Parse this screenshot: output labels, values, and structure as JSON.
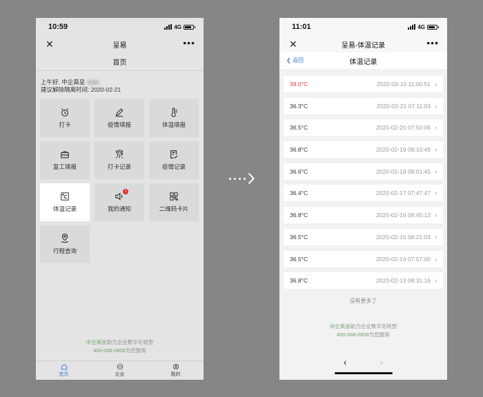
{
  "left": {
    "status_time": "10:59",
    "network": "4G",
    "app_title": "呈易",
    "page_title": "首页",
    "greeting": "上午好, 中企高呈",
    "quarantine_line": "建议解除隔离时间: 2020-02-21",
    "grid": [
      {
        "label": "打卡",
        "icon": "alarm-clock-icon"
      },
      {
        "label": "疫情填报",
        "icon": "pencil-icon"
      },
      {
        "label": "体温填报",
        "icon": "thermometer-icon"
      },
      {
        "label": "复工填报",
        "icon": "briefcase-icon"
      },
      {
        "label": "打卡记录",
        "icon": "fingerprint-icon"
      },
      {
        "label": "疫情记录",
        "icon": "document-check-icon"
      },
      {
        "label": "体温记录",
        "icon": "celsius-icon"
      },
      {
        "label": "我的通知",
        "icon": "speaker-icon",
        "badge": "1"
      },
      {
        "label": "二维码卡片",
        "icon": "qr-code-icon"
      },
      {
        "label": "行程查询",
        "icon": "map-pin-icon"
      }
    ],
    "footer_line1_brand": "中企高呈",
    "footer_line1_rest": "助力企业数字化转型",
    "footer_line2_phone": "400-068-0808",
    "footer_line2_rest": "为您服务",
    "tabs": [
      {
        "label": "首页",
        "icon": "home-icon",
        "active": true
      },
      {
        "label": "企业",
        "icon": "ellipsis-circle-icon",
        "active": false
      },
      {
        "label": "我的",
        "icon": "user-icon",
        "active": false
      }
    ]
  },
  "right": {
    "status_time": "11:01",
    "network": "4G",
    "app_title": "呈易-体温记录",
    "back_label": "返回",
    "page_title": "体温记录",
    "records": [
      {
        "temp": "39.0°C",
        "time": "2020-03-10 11:00:51",
        "fever": true
      },
      {
        "temp": "36.3°C",
        "time": "2020-02-21 07:11:03",
        "fever": false
      },
      {
        "temp": "36.5°C",
        "time": "2020-02-20 07:50:06",
        "fever": false
      },
      {
        "temp": "36.8°C",
        "time": "2020-02-19 08:10:49",
        "fever": false
      },
      {
        "temp": "36.6°C",
        "time": "2020-02-18 08:01:45",
        "fever": false
      },
      {
        "temp": "36.4°C",
        "time": "2020-02-17 07:47:47",
        "fever": false
      },
      {
        "temp": "36.8°C",
        "time": "2020-02-16 08:45:13",
        "fever": false
      },
      {
        "temp": "36.5°C",
        "time": "2020-02-15 08:21:03",
        "fever": false
      },
      {
        "temp": "36.5°C",
        "time": "2020-02-14 07:57:00",
        "fever": false
      },
      {
        "temp": "36.8°C",
        "time": "2020-02-13 08:31:16",
        "fever": false
      }
    ],
    "no_more": "没有更多了",
    "footer_line1_brand": "中企高呈",
    "footer_line1_rest": "助力企业数字化转型",
    "footer_line2_phone": "400-068-0808",
    "footer_line2_rest": "为您服务"
  },
  "colors": {
    "background": "#868686",
    "accent_blue": "#3d7fd6",
    "fever_red": "#e53a3a",
    "footer_green": "#6e9f6e",
    "badge_red": "#e0302a"
  }
}
